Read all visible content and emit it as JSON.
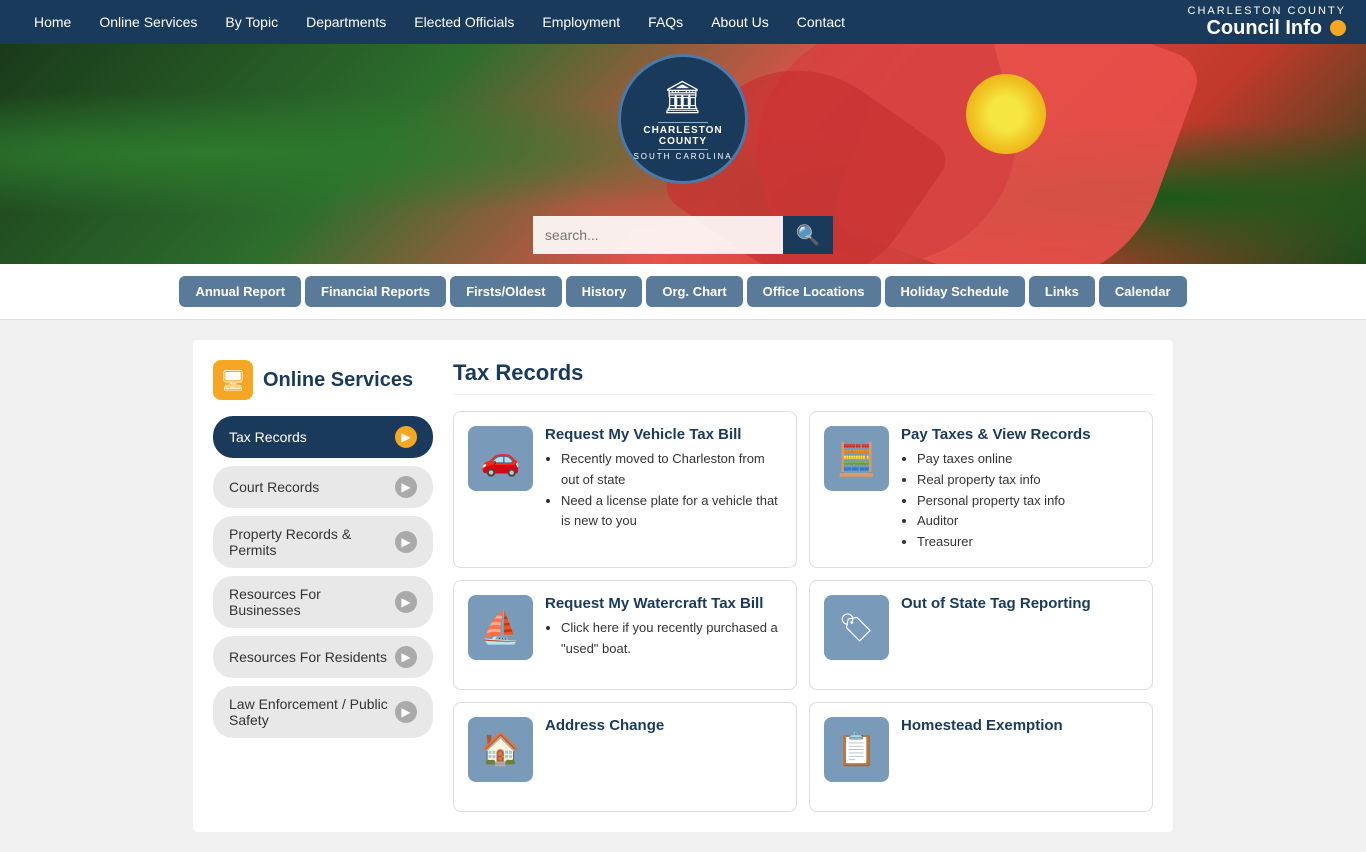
{
  "topnav": {
    "links": [
      "Home",
      "Online Services",
      "By Topic",
      "Departments",
      "Elected Officials",
      "Employment",
      "FAQs",
      "About Us",
      "Contact"
    ],
    "council_title": "CHARLESTON COUNTY",
    "council_link": "Council Info"
  },
  "logo": {
    "building_icon": "🏛",
    "line1": "CHARLESTON",
    "line2": "COUNTY",
    "line3": "SOUTH CAROLINA"
  },
  "search": {
    "placeholder": "search...",
    "button_icon": "🔍"
  },
  "tabs": [
    {
      "label": "Annual Report",
      "active": false
    },
    {
      "label": "Financial Reports",
      "active": false
    },
    {
      "label": "Firsts/Oldest",
      "active": false
    },
    {
      "label": "History",
      "active": false
    },
    {
      "label": "Org. Chart",
      "active": false
    },
    {
      "label": "Office Locations",
      "active": false
    },
    {
      "label": "Holiday Schedule",
      "active": false
    },
    {
      "label": "Links",
      "active": false
    },
    {
      "label": "Calendar",
      "active": false
    }
  ],
  "sidebar": {
    "icon": "🖥",
    "title": "Online Services",
    "items": [
      {
        "label": "Tax Records",
        "active": true
      },
      {
        "label": "Court Records",
        "active": false
      },
      {
        "label": "Property Records & Permits",
        "active": false
      },
      {
        "label": "Resources For Businesses",
        "active": false
      },
      {
        "label": "Resources For Residents",
        "active": false
      },
      {
        "label": "Law Enforcement / Public Safety",
        "active": false
      }
    ]
  },
  "content": {
    "title": "Tax Records",
    "cards": [
      {
        "icon": "🚗",
        "title": "Request My Vehicle Tax Bill",
        "bullets": [
          "Recently moved to Charleston from out of state",
          "Need a license plate for a vehicle that is new to you"
        ]
      },
      {
        "icon": "🧮",
        "title": "Pay Taxes & View Records",
        "bullets": [
          "Pay taxes online",
          "Real property tax info",
          "Personal property tax info",
          "Auditor",
          "Treasurer"
        ]
      },
      {
        "icon": "⛵",
        "title": "Request My Watercraft Tax Bill",
        "bullets": [
          "Click here if you recently purchased a \"used\" boat."
        ]
      },
      {
        "icon": "🏷",
        "title": "Out of State Tag Reporting",
        "bullets": []
      },
      {
        "icon": "🏠",
        "title": "Address Change",
        "bullets": []
      },
      {
        "icon": "📋",
        "title": "Homestead Exemption",
        "bullets": []
      }
    ]
  }
}
